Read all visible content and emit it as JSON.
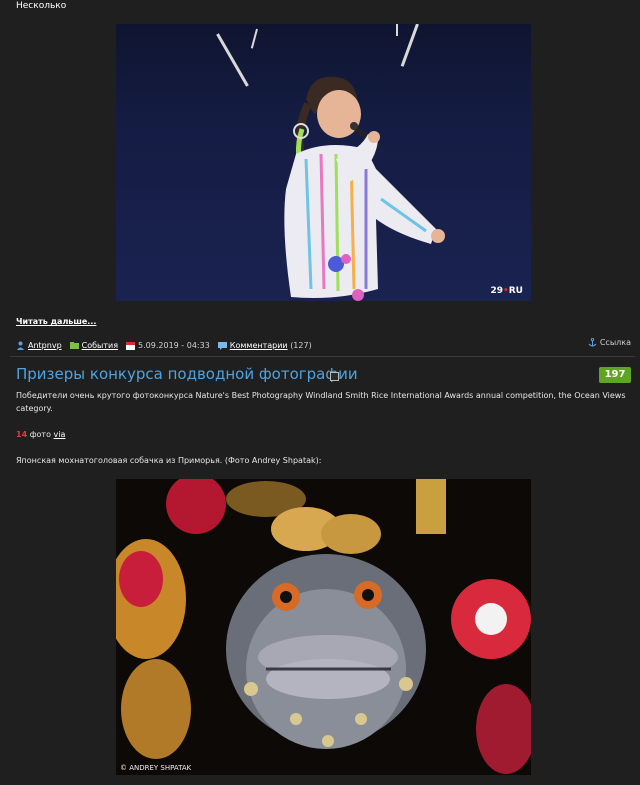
{
  "top_text": "Несколько",
  "photo1": {
    "watermark_main": "29",
    "watermark_dot": "•",
    "watermark_suffix": "RU"
  },
  "read_more": "Читать дальше...",
  "meta": {
    "author": "Antpnvp",
    "category": "События",
    "date": "5.09.2019 - 04:33",
    "comments_label": "Комментарии",
    "comments_count": "(127)",
    "link_label": "Ссылка"
  },
  "post": {
    "title": "Призеры конкурса подводной фотографии",
    "score": "197",
    "description": "Победители очень крутого фотоконкурса Nature's Best Photography Windland Smith Rice International Awards annual competition, the Ocean Views category.",
    "photo_count": "14",
    "photo_word": "фото",
    "via": "via",
    "caption": "Японская мохнатоголовая собачка из Приморья. (Фото Andrey Shpatak):",
    "photo_watermark": "© ANDREY SHPATAK"
  },
  "colors": {
    "title": "#4fa3e0",
    "score_bg": "#5fa521",
    "count": "#e23c3c",
    "background": "#1f1f1f"
  }
}
